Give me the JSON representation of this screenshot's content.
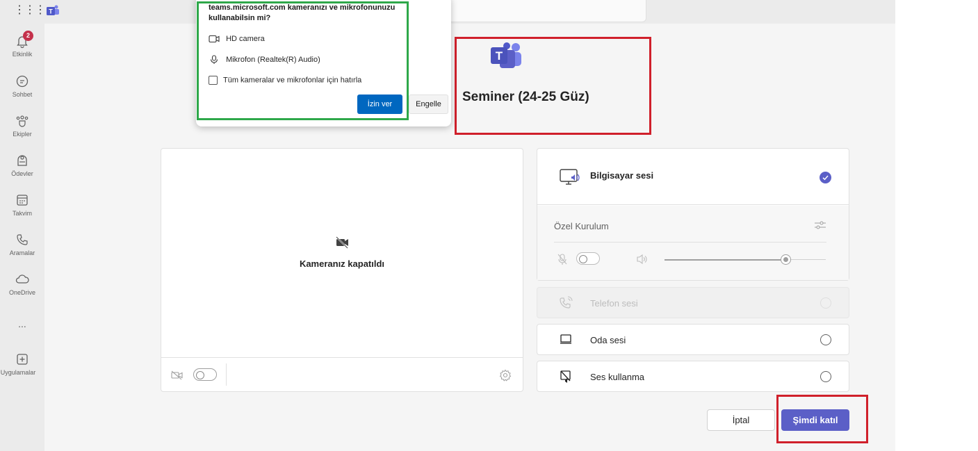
{
  "rail": {
    "badge_count": "2",
    "items": [
      {
        "label": "Etkinlik",
        "icon": "bell-icon"
      },
      {
        "label": "Sohbet",
        "icon": "chat-icon"
      },
      {
        "label": "Ekipler",
        "icon": "teams-icon"
      },
      {
        "label": "Ödevler",
        "icon": "assignments-icon"
      },
      {
        "label": "Takvim",
        "icon": "calendar-icon"
      },
      {
        "label": "Aramalar",
        "icon": "phone-icon"
      },
      {
        "label": "OneDrive",
        "icon": "cloud-icon"
      },
      {
        "label": "Uygulamalar",
        "icon": "plus-icon"
      }
    ],
    "more": "..."
  },
  "popup": {
    "title": "teams.microsoft.com kameranızı ve mikrofonunuzu kullanabilsin mi?",
    "camera": "HD camera",
    "microphone": "Mikrofon (Realtek(R) Audio)",
    "remember": "Tüm kameralar ve mikrofonlar için hatırla",
    "allow": "İzin ver",
    "block": "Engelle"
  },
  "meeting": {
    "title": "Seminer (24-25 Güz)"
  },
  "video": {
    "off_label": "Kameranız kapatıldı"
  },
  "audio": {
    "computer": "Bilgisayar sesi",
    "custom": "Özel Kurulum",
    "phone": "Telefon sesi",
    "room": "Oda sesi",
    "none": "Ses kullanma",
    "volume_level": 0.75
  },
  "actions": {
    "cancel": "İptal",
    "join": "Şimdi katıl"
  },
  "colors": {
    "accent": "#5b5fc7",
    "highlight_red": "#d0202b",
    "highlight_green": "#2ea84a",
    "browser_blue": "#0067c0"
  }
}
